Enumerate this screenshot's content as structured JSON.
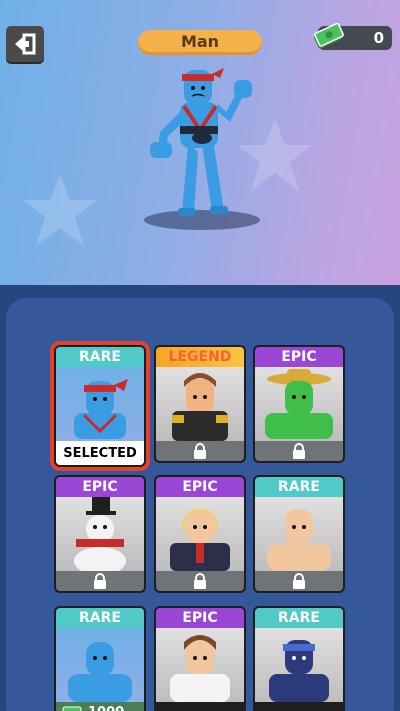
{
  "header": {
    "title": "Man",
    "cash": "0"
  },
  "cards": [
    {
      "rarity": "RARE",
      "status": "SELECTED",
      "locked": false
    },
    {
      "rarity": "LEGEND",
      "status": "",
      "locked": true
    },
    {
      "rarity": "EPIC",
      "status": "",
      "locked": true
    },
    {
      "rarity": "EPIC",
      "status": "",
      "locked": true
    },
    {
      "rarity": "EPIC",
      "status": "",
      "locked": true
    },
    {
      "rarity": "RARE",
      "status": "",
      "locked": true
    },
    {
      "rarity": "RARE",
      "status": "",
      "locked": false,
      "price": "1000"
    },
    {
      "rarity": "EPIC",
      "status": "",
      "locked": false
    },
    {
      "rarity": "RARE",
      "status": "",
      "locked": false
    }
  ],
  "colors": {
    "rare": "#4fcac8",
    "epic": "#9a47d6",
    "legend": "#f5a623",
    "selected_outline": "#e2412c",
    "panel": "#35589a"
  },
  "icons": {
    "back": "exit-icon",
    "cash": "cash-icon",
    "lock": "lock-icon"
  }
}
